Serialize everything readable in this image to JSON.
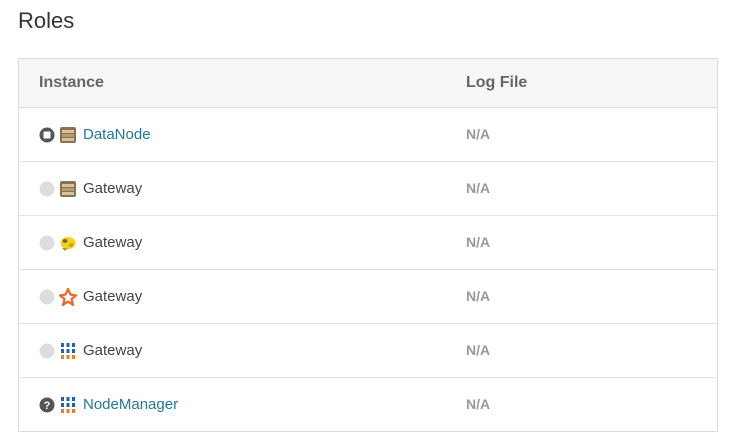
{
  "page": {
    "title": "Roles"
  },
  "table": {
    "headers": {
      "instance": "Instance",
      "log_file": "Log File"
    },
    "rows": [
      {
        "status_icon": "stopped-status-icon",
        "service_icon": "hdfs-icon",
        "name": "DataNode",
        "is_link": true,
        "log": "N/A"
      },
      {
        "status_icon": "none-status-icon",
        "service_icon": "hdfs-icon",
        "name": "Gateway",
        "is_link": false,
        "log": "N/A"
      },
      {
        "status_icon": "none-status-icon",
        "service_icon": "hive-icon",
        "name": "Gateway",
        "is_link": false,
        "log": "N/A"
      },
      {
        "status_icon": "none-status-icon",
        "service_icon": "spark-icon",
        "name": "Gateway",
        "is_link": false,
        "log": "N/A"
      },
      {
        "status_icon": "none-status-icon",
        "service_icon": "yarn-icon",
        "name": "Gateway",
        "is_link": false,
        "log": "N/A"
      },
      {
        "status_icon": "unknown-status-icon",
        "service_icon": "yarn-icon",
        "name": "NodeManager",
        "is_link": true,
        "log": "N/A"
      }
    ]
  },
  "colors": {
    "link": "#23769a",
    "na": "#9a9a9a",
    "header_bg": "#f6f6f6"
  }
}
